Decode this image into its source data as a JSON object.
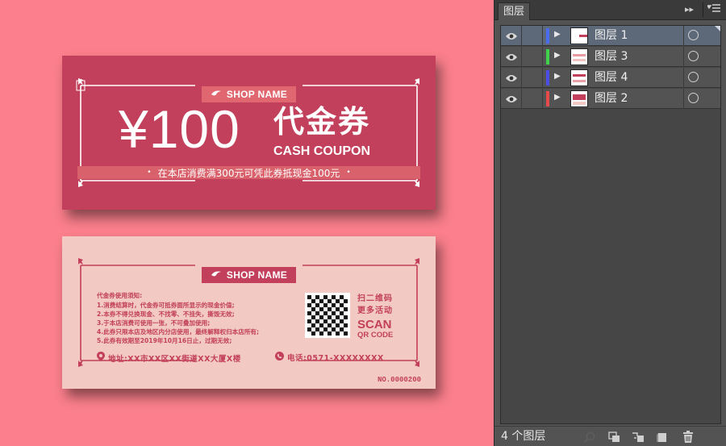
{
  "canvas": {
    "front": {
      "shop_name": "SHOP NAME",
      "price": "¥100",
      "coupon_cn": "代金券",
      "coupon_en": "CASH COUPON",
      "terms": "在本店消费满300元可凭此券抵现金100元"
    },
    "back": {
      "shop_name": "SHOP NAME",
      "notice_title": "代金券使用须知:",
      "notice_items": [
        "1.消费结算时，代金券可抵券面所显示的现金价值;",
        "2.本券不得兑换现金、不找零、不挂失，撕毁无效;",
        "3.于本店消费可使用一张，不可叠加使用;",
        "4.此券只限本店及地区内分店使用，最终解释权归本店所有;",
        "5.此券有效期至2019年10月16日止，过期无效;"
      ],
      "scan_cn_1": "扫二维码",
      "scan_cn_2": "更多活动",
      "scan_en": "SCAN",
      "qr_code": "QR CODE",
      "address": "地址:XX市XX区XX街道XX大厦X楼",
      "phone": "电话:0571-XXXXXXXX",
      "serial": "NO.0000200"
    }
  },
  "layers_panel": {
    "tab": "图层",
    "layers": [
      {
        "name": "图层 1",
        "color": "#4a6cf0",
        "selected": true
      },
      {
        "name": "图层 3",
        "color": "#3fd14a",
        "selected": false
      },
      {
        "name": "图层 4",
        "color": "#4a4ee6",
        "selected": false
      },
      {
        "name": "图层 2",
        "color": "#e64a4a",
        "selected": false
      }
    ],
    "footer_count": "4 个图层"
  },
  "colors": {
    "background": "#fb7f8c",
    "coupon_front": "#c2405b",
    "coupon_back": "#f3c9c3"
  }
}
